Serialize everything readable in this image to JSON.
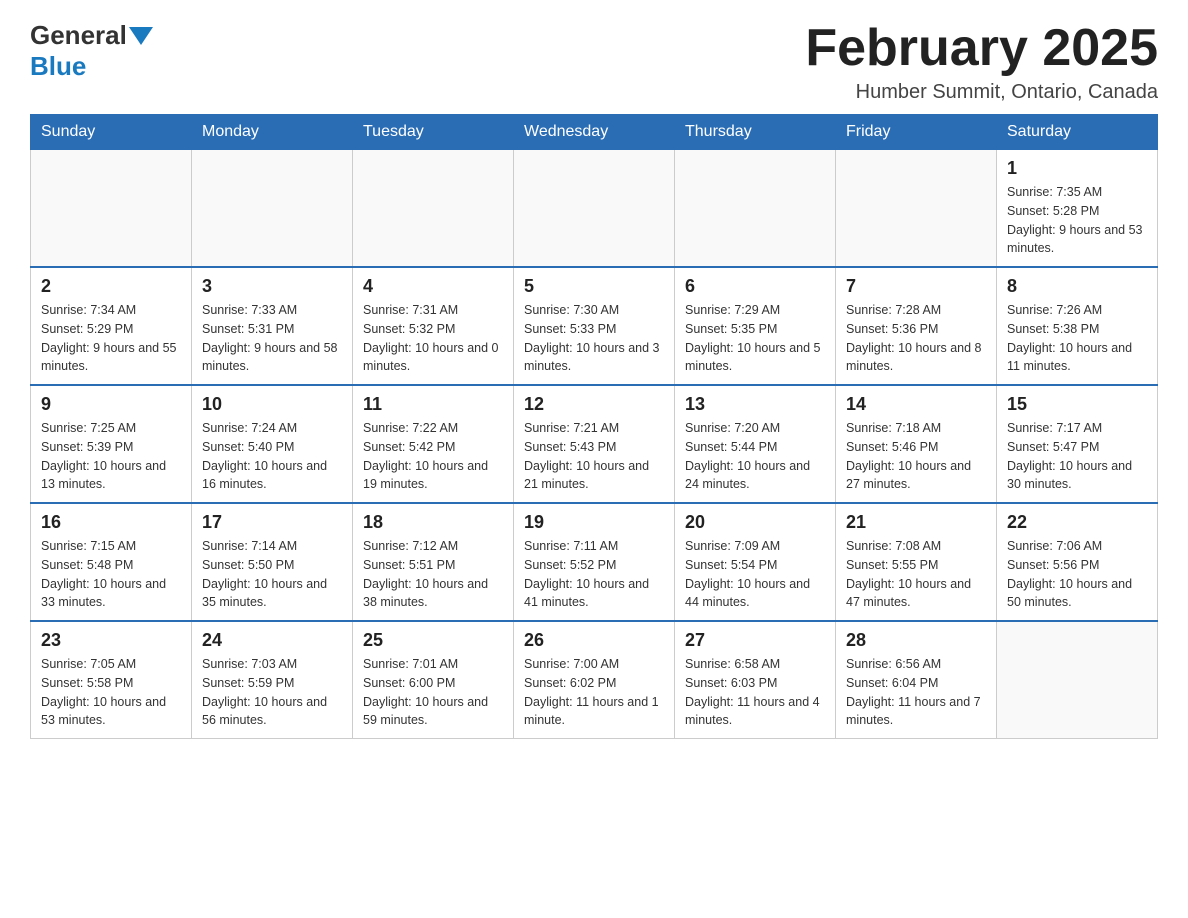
{
  "header": {
    "logo_general": "General",
    "logo_blue": "Blue",
    "month_title": "February 2025",
    "location": "Humber Summit, Ontario, Canada"
  },
  "days_of_week": [
    "Sunday",
    "Monday",
    "Tuesday",
    "Wednesday",
    "Thursday",
    "Friday",
    "Saturday"
  ],
  "weeks": [
    {
      "days": [
        {
          "date": "",
          "info": ""
        },
        {
          "date": "",
          "info": ""
        },
        {
          "date": "",
          "info": ""
        },
        {
          "date": "",
          "info": ""
        },
        {
          "date": "",
          "info": ""
        },
        {
          "date": "",
          "info": ""
        },
        {
          "date": "1",
          "info": "Sunrise: 7:35 AM\nSunset: 5:28 PM\nDaylight: 9 hours\nand 53 minutes."
        }
      ]
    },
    {
      "days": [
        {
          "date": "2",
          "info": "Sunrise: 7:34 AM\nSunset: 5:29 PM\nDaylight: 9 hours\nand 55 minutes."
        },
        {
          "date": "3",
          "info": "Sunrise: 7:33 AM\nSunset: 5:31 PM\nDaylight: 9 hours\nand 58 minutes."
        },
        {
          "date": "4",
          "info": "Sunrise: 7:31 AM\nSunset: 5:32 PM\nDaylight: 10 hours\nand 0 minutes."
        },
        {
          "date": "5",
          "info": "Sunrise: 7:30 AM\nSunset: 5:33 PM\nDaylight: 10 hours\nand 3 minutes."
        },
        {
          "date": "6",
          "info": "Sunrise: 7:29 AM\nSunset: 5:35 PM\nDaylight: 10 hours\nand 5 minutes."
        },
        {
          "date": "7",
          "info": "Sunrise: 7:28 AM\nSunset: 5:36 PM\nDaylight: 10 hours\nand 8 minutes."
        },
        {
          "date": "8",
          "info": "Sunrise: 7:26 AM\nSunset: 5:38 PM\nDaylight: 10 hours\nand 11 minutes."
        }
      ]
    },
    {
      "days": [
        {
          "date": "9",
          "info": "Sunrise: 7:25 AM\nSunset: 5:39 PM\nDaylight: 10 hours\nand 13 minutes."
        },
        {
          "date": "10",
          "info": "Sunrise: 7:24 AM\nSunset: 5:40 PM\nDaylight: 10 hours\nand 16 minutes."
        },
        {
          "date": "11",
          "info": "Sunrise: 7:22 AM\nSunset: 5:42 PM\nDaylight: 10 hours\nand 19 minutes."
        },
        {
          "date": "12",
          "info": "Sunrise: 7:21 AM\nSunset: 5:43 PM\nDaylight: 10 hours\nand 21 minutes."
        },
        {
          "date": "13",
          "info": "Sunrise: 7:20 AM\nSunset: 5:44 PM\nDaylight: 10 hours\nand 24 minutes."
        },
        {
          "date": "14",
          "info": "Sunrise: 7:18 AM\nSunset: 5:46 PM\nDaylight: 10 hours\nand 27 minutes."
        },
        {
          "date": "15",
          "info": "Sunrise: 7:17 AM\nSunset: 5:47 PM\nDaylight: 10 hours\nand 30 minutes."
        }
      ]
    },
    {
      "days": [
        {
          "date": "16",
          "info": "Sunrise: 7:15 AM\nSunset: 5:48 PM\nDaylight: 10 hours\nand 33 minutes."
        },
        {
          "date": "17",
          "info": "Sunrise: 7:14 AM\nSunset: 5:50 PM\nDaylight: 10 hours\nand 35 minutes."
        },
        {
          "date": "18",
          "info": "Sunrise: 7:12 AM\nSunset: 5:51 PM\nDaylight: 10 hours\nand 38 minutes."
        },
        {
          "date": "19",
          "info": "Sunrise: 7:11 AM\nSunset: 5:52 PM\nDaylight: 10 hours\nand 41 minutes."
        },
        {
          "date": "20",
          "info": "Sunrise: 7:09 AM\nSunset: 5:54 PM\nDaylight: 10 hours\nand 44 minutes."
        },
        {
          "date": "21",
          "info": "Sunrise: 7:08 AM\nSunset: 5:55 PM\nDaylight: 10 hours\nand 47 minutes."
        },
        {
          "date": "22",
          "info": "Sunrise: 7:06 AM\nSunset: 5:56 PM\nDaylight: 10 hours\nand 50 minutes."
        }
      ]
    },
    {
      "days": [
        {
          "date": "23",
          "info": "Sunrise: 7:05 AM\nSunset: 5:58 PM\nDaylight: 10 hours\nand 53 minutes."
        },
        {
          "date": "24",
          "info": "Sunrise: 7:03 AM\nSunset: 5:59 PM\nDaylight: 10 hours\nand 56 minutes."
        },
        {
          "date": "25",
          "info": "Sunrise: 7:01 AM\nSunset: 6:00 PM\nDaylight: 10 hours\nand 59 minutes."
        },
        {
          "date": "26",
          "info": "Sunrise: 7:00 AM\nSunset: 6:02 PM\nDaylight: 11 hours\nand 1 minute."
        },
        {
          "date": "27",
          "info": "Sunrise: 6:58 AM\nSunset: 6:03 PM\nDaylight: 11 hours\nand 4 minutes."
        },
        {
          "date": "28",
          "info": "Sunrise: 6:56 AM\nSunset: 6:04 PM\nDaylight: 11 hours\nand 7 minutes."
        },
        {
          "date": "",
          "info": ""
        }
      ]
    }
  ]
}
